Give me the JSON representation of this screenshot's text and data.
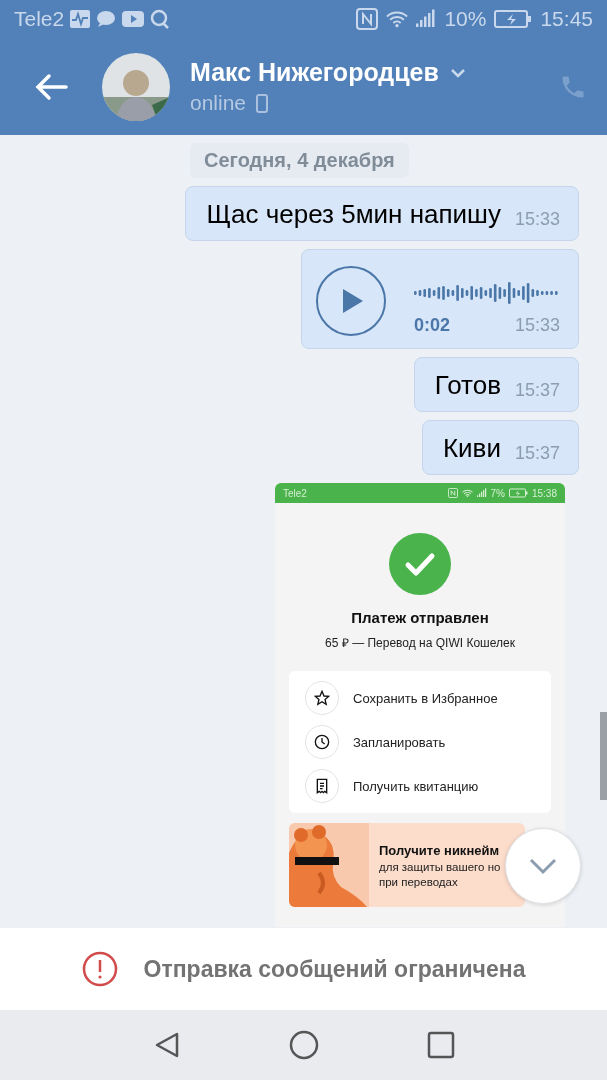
{
  "status_bar": {
    "carrier": "Tele2",
    "battery": "10%",
    "time": "15:45"
  },
  "header": {
    "name": "Макс Нижегородцев",
    "status": "online"
  },
  "date_separator": "Сегодня, 4 декабря",
  "messages": [
    {
      "kind": "text",
      "text": "Щас через 5мин напишу",
      "time": "15:33"
    },
    {
      "kind": "voice",
      "duration": "0:02",
      "time": "15:33"
    },
    {
      "kind": "text",
      "text": "Готов",
      "time": "15:37"
    },
    {
      "kind": "text",
      "text": "Киви",
      "time": "15:37"
    },
    {
      "kind": "screenshot",
      "screenshot": {
        "status_bar": {
          "carrier": "Tele2",
          "battery": "7%",
          "time": "15:38"
        },
        "title": "Платеж отправлен",
        "subtitle": "65 ₽ — Перевод на QIWI Кошелек",
        "actions": [
          {
            "kind": "star",
            "label": "Сохранить в Избранное"
          },
          {
            "kind": "clock",
            "label": "Запланировать"
          },
          {
            "kind": "receipt",
            "label": "Получить квитанцию"
          }
        ],
        "promo": {
          "title": "Получите никнейм",
          "lines": [
            "для защиты вашего но",
            "при переводах"
          ]
        }
      }
    }
  ],
  "notice": "Отправка сообщений ограничена"
}
